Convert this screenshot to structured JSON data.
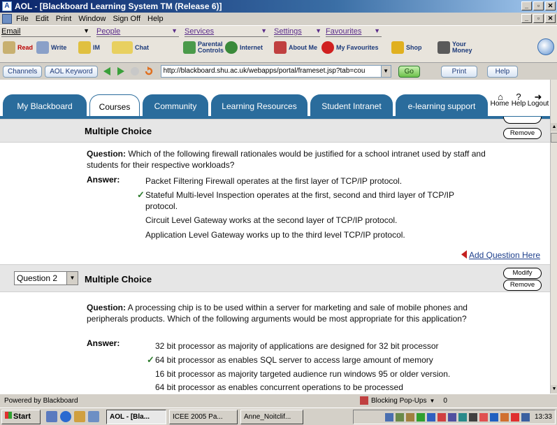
{
  "window": {
    "title": "AOL - [Blackboard Learning System TM (Release 6)]"
  },
  "menu": {
    "items": [
      "File",
      "Edit",
      "Print",
      "Window",
      "Sign Off",
      "Help"
    ]
  },
  "aol_toolbar": {
    "categories": [
      "Email",
      "People",
      "Services",
      "Settings",
      "Favourites"
    ],
    "buttons": [
      "Read",
      "Write",
      "IM",
      "Chat",
      "Parental Controls",
      "Internet",
      "About Me",
      "My Favourites",
      "Shop",
      "Your Money"
    ]
  },
  "navbar": {
    "channels": "Channels",
    "keyword": "AOL Keyword",
    "address": "http://blackboard.shu.ac.uk/webapps/portal/frameset.jsp?tab=cou",
    "go": "Go",
    "print": "Print",
    "help": "Help"
  },
  "blackboard": {
    "tabs": [
      "My Blackboard",
      "Courses",
      "Community",
      "Learning Resources",
      "Student Intranet",
      "e-learning support"
    ],
    "active_tab": "Courses",
    "header_links": [
      "Home",
      "Help",
      "Logout"
    ]
  },
  "questions": [
    {
      "type": "Multiple Choice",
      "remove": "Remove",
      "question_label": "Question:",
      "question": "Which of the following firewall rationales would be justified for a school intranet used by staff and students for their respective workloads?",
      "answer_label": "Answer:",
      "answers": [
        "Packet Filtering Firewall operates at the first layer of TCP/IP protocol.",
        "Stateful Multi-level Inspection operates at the first, second and third layer of TCP/IP protocol.",
        "Circuit Level Gateway works at the second layer of TCP/IP protocol.",
        "Application Level Gateway works up to the third level TCP/IP protocol."
      ],
      "correct_index": 1,
      "add_question": "Add Question Here"
    },
    {
      "selector": "Question 2",
      "type": "Multiple Choice",
      "modify": "Modify",
      "remove": "Remove",
      "question_label": "Question:",
      "question": "A processing chip is to be used within a server for marketing and sale of mobile phones and peripherals products. Which of the following arguments would be most appropriate for this application?",
      "answer_label": "Answer:",
      "answers": [
        "32 bit processor as majority of applications are designed for 32 bit processor",
        "64 bit processor as enables SQL server to access large amount of memory",
        "16 bit processor as majority targeted audience run windows 95 or older version.",
        "64 bit processor as enables concurrent operations to be processed"
      ],
      "correct_index": 1
    }
  ],
  "status": {
    "left": "Powered by Blackboard",
    "blocker": "Blocking Pop-Ups",
    "count": "0"
  },
  "taskbar": {
    "start": "Start",
    "tasks": [
      "AOL - [Bla...",
      "ICEE 2005 Pa...",
      "Anne_Noitclif..."
    ],
    "clock": "13:33"
  },
  "colors": {
    "tab_blue": "#2a6c9c",
    "check_green": "#2b7a2b",
    "link_blue": "#1d3f8c"
  }
}
